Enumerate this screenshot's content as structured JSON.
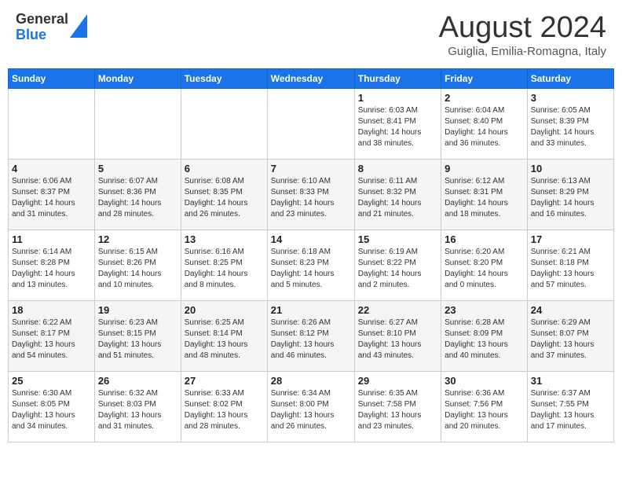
{
  "header": {
    "logo_line1": "General",
    "logo_line2": "Blue",
    "month": "August 2024",
    "location": "Guiglia, Emilia-Romagna, Italy"
  },
  "weekdays": [
    "Sunday",
    "Monday",
    "Tuesday",
    "Wednesday",
    "Thursday",
    "Friday",
    "Saturday"
  ],
  "weeks": [
    [
      {
        "day": "",
        "info": ""
      },
      {
        "day": "",
        "info": ""
      },
      {
        "day": "",
        "info": ""
      },
      {
        "day": "",
        "info": ""
      },
      {
        "day": "1",
        "info": "Sunrise: 6:03 AM\nSunset: 8:41 PM\nDaylight: 14 hours\nand 38 minutes."
      },
      {
        "day": "2",
        "info": "Sunrise: 6:04 AM\nSunset: 8:40 PM\nDaylight: 14 hours\nand 36 minutes."
      },
      {
        "day": "3",
        "info": "Sunrise: 6:05 AM\nSunset: 8:39 PM\nDaylight: 14 hours\nand 33 minutes."
      }
    ],
    [
      {
        "day": "4",
        "info": "Sunrise: 6:06 AM\nSunset: 8:37 PM\nDaylight: 14 hours\nand 31 minutes."
      },
      {
        "day": "5",
        "info": "Sunrise: 6:07 AM\nSunset: 8:36 PM\nDaylight: 14 hours\nand 28 minutes."
      },
      {
        "day": "6",
        "info": "Sunrise: 6:08 AM\nSunset: 8:35 PM\nDaylight: 14 hours\nand 26 minutes."
      },
      {
        "day": "7",
        "info": "Sunrise: 6:10 AM\nSunset: 8:33 PM\nDaylight: 14 hours\nand 23 minutes."
      },
      {
        "day": "8",
        "info": "Sunrise: 6:11 AM\nSunset: 8:32 PM\nDaylight: 14 hours\nand 21 minutes."
      },
      {
        "day": "9",
        "info": "Sunrise: 6:12 AM\nSunset: 8:31 PM\nDaylight: 14 hours\nand 18 minutes."
      },
      {
        "day": "10",
        "info": "Sunrise: 6:13 AM\nSunset: 8:29 PM\nDaylight: 14 hours\nand 16 minutes."
      }
    ],
    [
      {
        "day": "11",
        "info": "Sunrise: 6:14 AM\nSunset: 8:28 PM\nDaylight: 14 hours\nand 13 minutes."
      },
      {
        "day": "12",
        "info": "Sunrise: 6:15 AM\nSunset: 8:26 PM\nDaylight: 14 hours\nand 10 minutes."
      },
      {
        "day": "13",
        "info": "Sunrise: 6:16 AM\nSunset: 8:25 PM\nDaylight: 14 hours\nand 8 minutes."
      },
      {
        "day": "14",
        "info": "Sunrise: 6:18 AM\nSunset: 8:23 PM\nDaylight: 14 hours\nand 5 minutes."
      },
      {
        "day": "15",
        "info": "Sunrise: 6:19 AM\nSunset: 8:22 PM\nDaylight: 14 hours\nand 2 minutes."
      },
      {
        "day": "16",
        "info": "Sunrise: 6:20 AM\nSunset: 8:20 PM\nDaylight: 14 hours\nand 0 minutes."
      },
      {
        "day": "17",
        "info": "Sunrise: 6:21 AM\nSunset: 8:18 PM\nDaylight: 13 hours\nand 57 minutes."
      }
    ],
    [
      {
        "day": "18",
        "info": "Sunrise: 6:22 AM\nSunset: 8:17 PM\nDaylight: 13 hours\nand 54 minutes."
      },
      {
        "day": "19",
        "info": "Sunrise: 6:23 AM\nSunset: 8:15 PM\nDaylight: 13 hours\nand 51 minutes."
      },
      {
        "day": "20",
        "info": "Sunrise: 6:25 AM\nSunset: 8:14 PM\nDaylight: 13 hours\nand 48 minutes."
      },
      {
        "day": "21",
        "info": "Sunrise: 6:26 AM\nSunset: 8:12 PM\nDaylight: 13 hours\nand 46 minutes."
      },
      {
        "day": "22",
        "info": "Sunrise: 6:27 AM\nSunset: 8:10 PM\nDaylight: 13 hours\nand 43 minutes."
      },
      {
        "day": "23",
        "info": "Sunrise: 6:28 AM\nSunset: 8:09 PM\nDaylight: 13 hours\nand 40 minutes."
      },
      {
        "day": "24",
        "info": "Sunrise: 6:29 AM\nSunset: 8:07 PM\nDaylight: 13 hours\nand 37 minutes."
      }
    ],
    [
      {
        "day": "25",
        "info": "Sunrise: 6:30 AM\nSunset: 8:05 PM\nDaylight: 13 hours\nand 34 minutes."
      },
      {
        "day": "26",
        "info": "Sunrise: 6:32 AM\nSunset: 8:03 PM\nDaylight: 13 hours\nand 31 minutes."
      },
      {
        "day": "27",
        "info": "Sunrise: 6:33 AM\nSunset: 8:02 PM\nDaylight: 13 hours\nand 28 minutes."
      },
      {
        "day": "28",
        "info": "Sunrise: 6:34 AM\nSunset: 8:00 PM\nDaylight: 13 hours\nand 26 minutes."
      },
      {
        "day": "29",
        "info": "Sunrise: 6:35 AM\nSunset: 7:58 PM\nDaylight: 13 hours\nand 23 minutes."
      },
      {
        "day": "30",
        "info": "Sunrise: 6:36 AM\nSunset: 7:56 PM\nDaylight: 13 hours\nand 20 minutes."
      },
      {
        "day": "31",
        "info": "Sunrise: 6:37 AM\nSunset: 7:55 PM\nDaylight: 13 hours\nand 17 minutes."
      }
    ]
  ]
}
